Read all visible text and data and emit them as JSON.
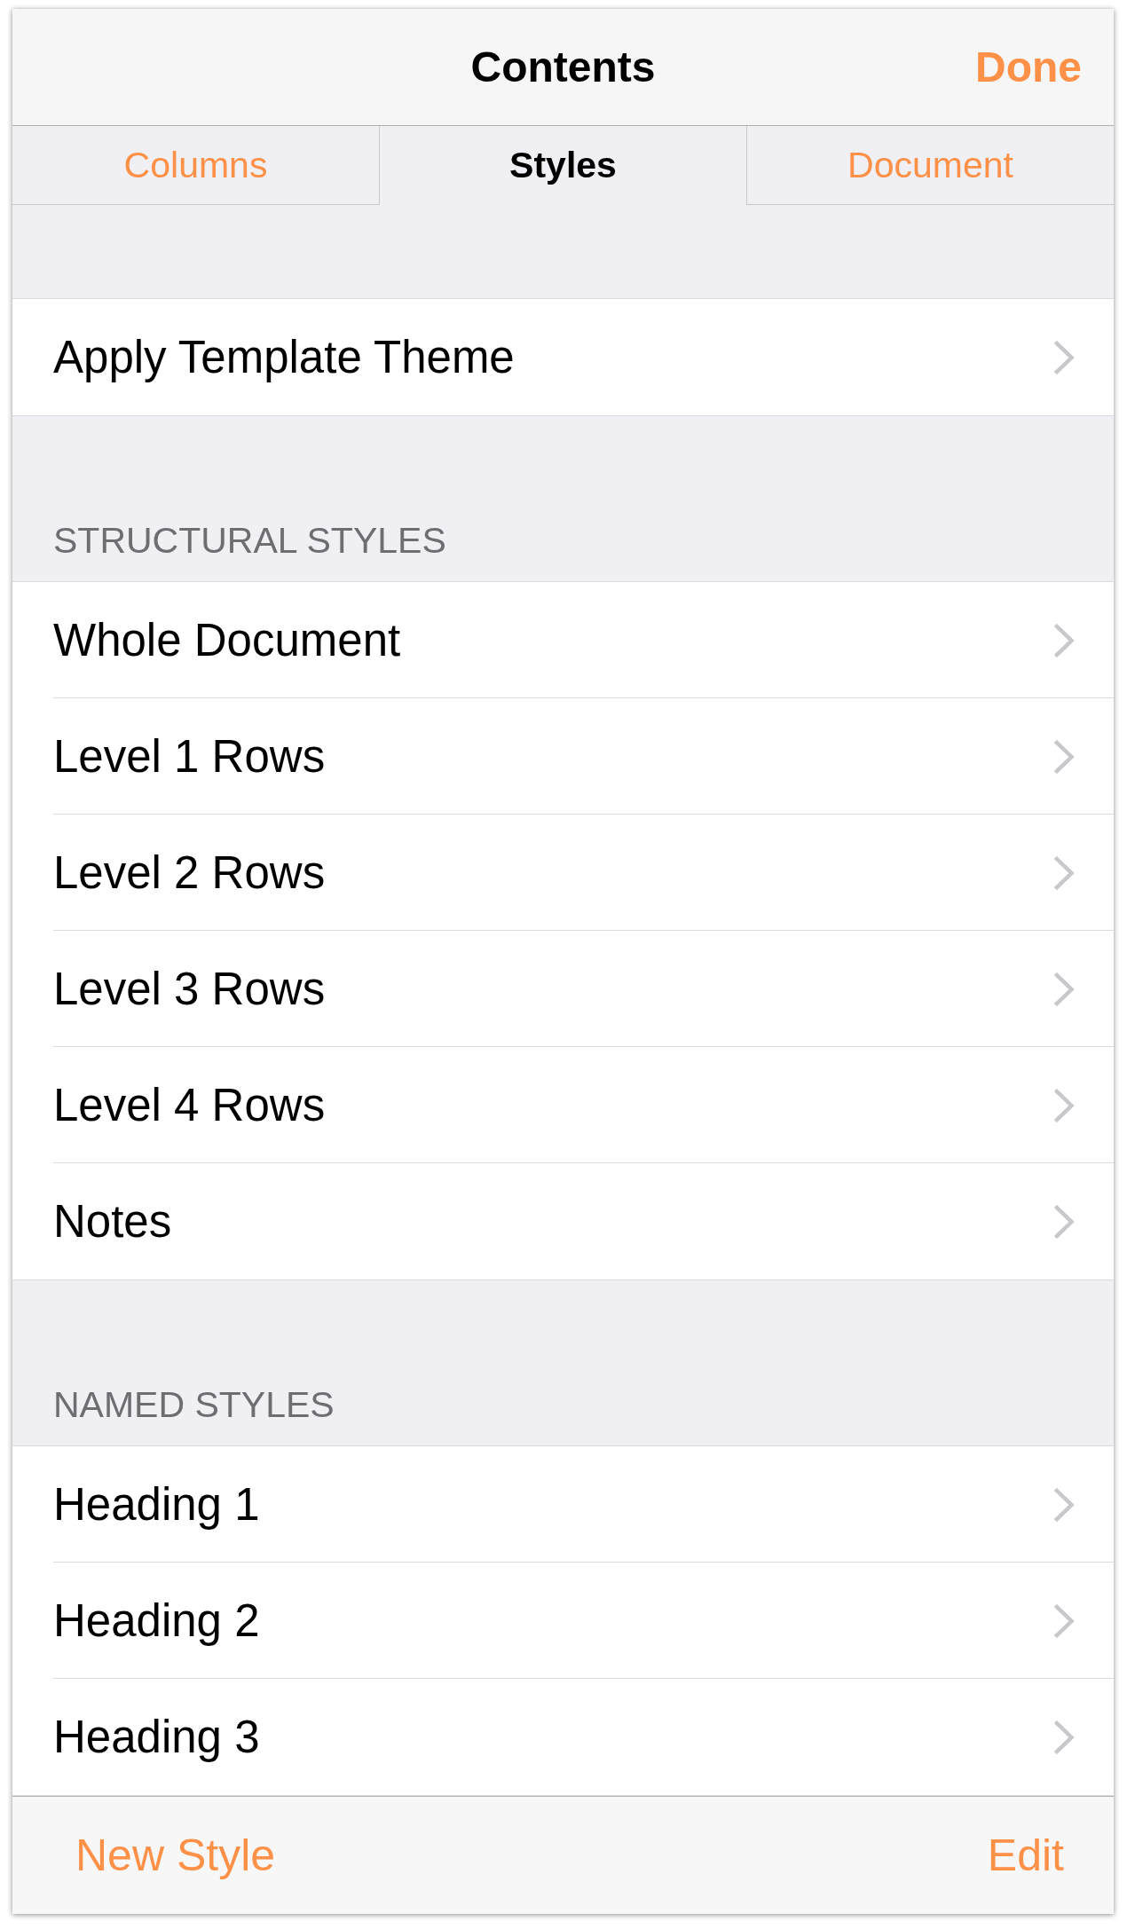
{
  "navigation_bar": {
    "title": "Contents",
    "done_button": "Done"
  },
  "tabs": [
    {
      "label": "Columns",
      "selected": false
    },
    {
      "label": "Styles",
      "selected": true
    },
    {
      "label": "Document",
      "selected": false
    }
  ],
  "sections": [
    {
      "rows": [
        {
          "label": "Apply Template Theme"
        }
      ]
    },
    {
      "header": "STRUCTURAL STYLES",
      "rows": [
        {
          "label": "Whole Document"
        },
        {
          "label": "Level 1 Rows"
        },
        {
          "label": "Level 2 Rows"
        },
        {
          "label": "Level 3 Rows"
        },
        {
          "label": "Level 4 Rows"
        },
        {
          "label": "Notes"
        }
      ]
    },
    {
      "header": "NAMED STYLES",
      "rows": [
        {
          "label": "Heading 1"
        },
        {
          "label": "Heading 2"
        },
        {
          "label": "Heading 3"
        }
      ]
    }
  ],
  "toolbar": {
    "new_style_button": "New Style",
    "edit_button": "Edit"
  }
}
